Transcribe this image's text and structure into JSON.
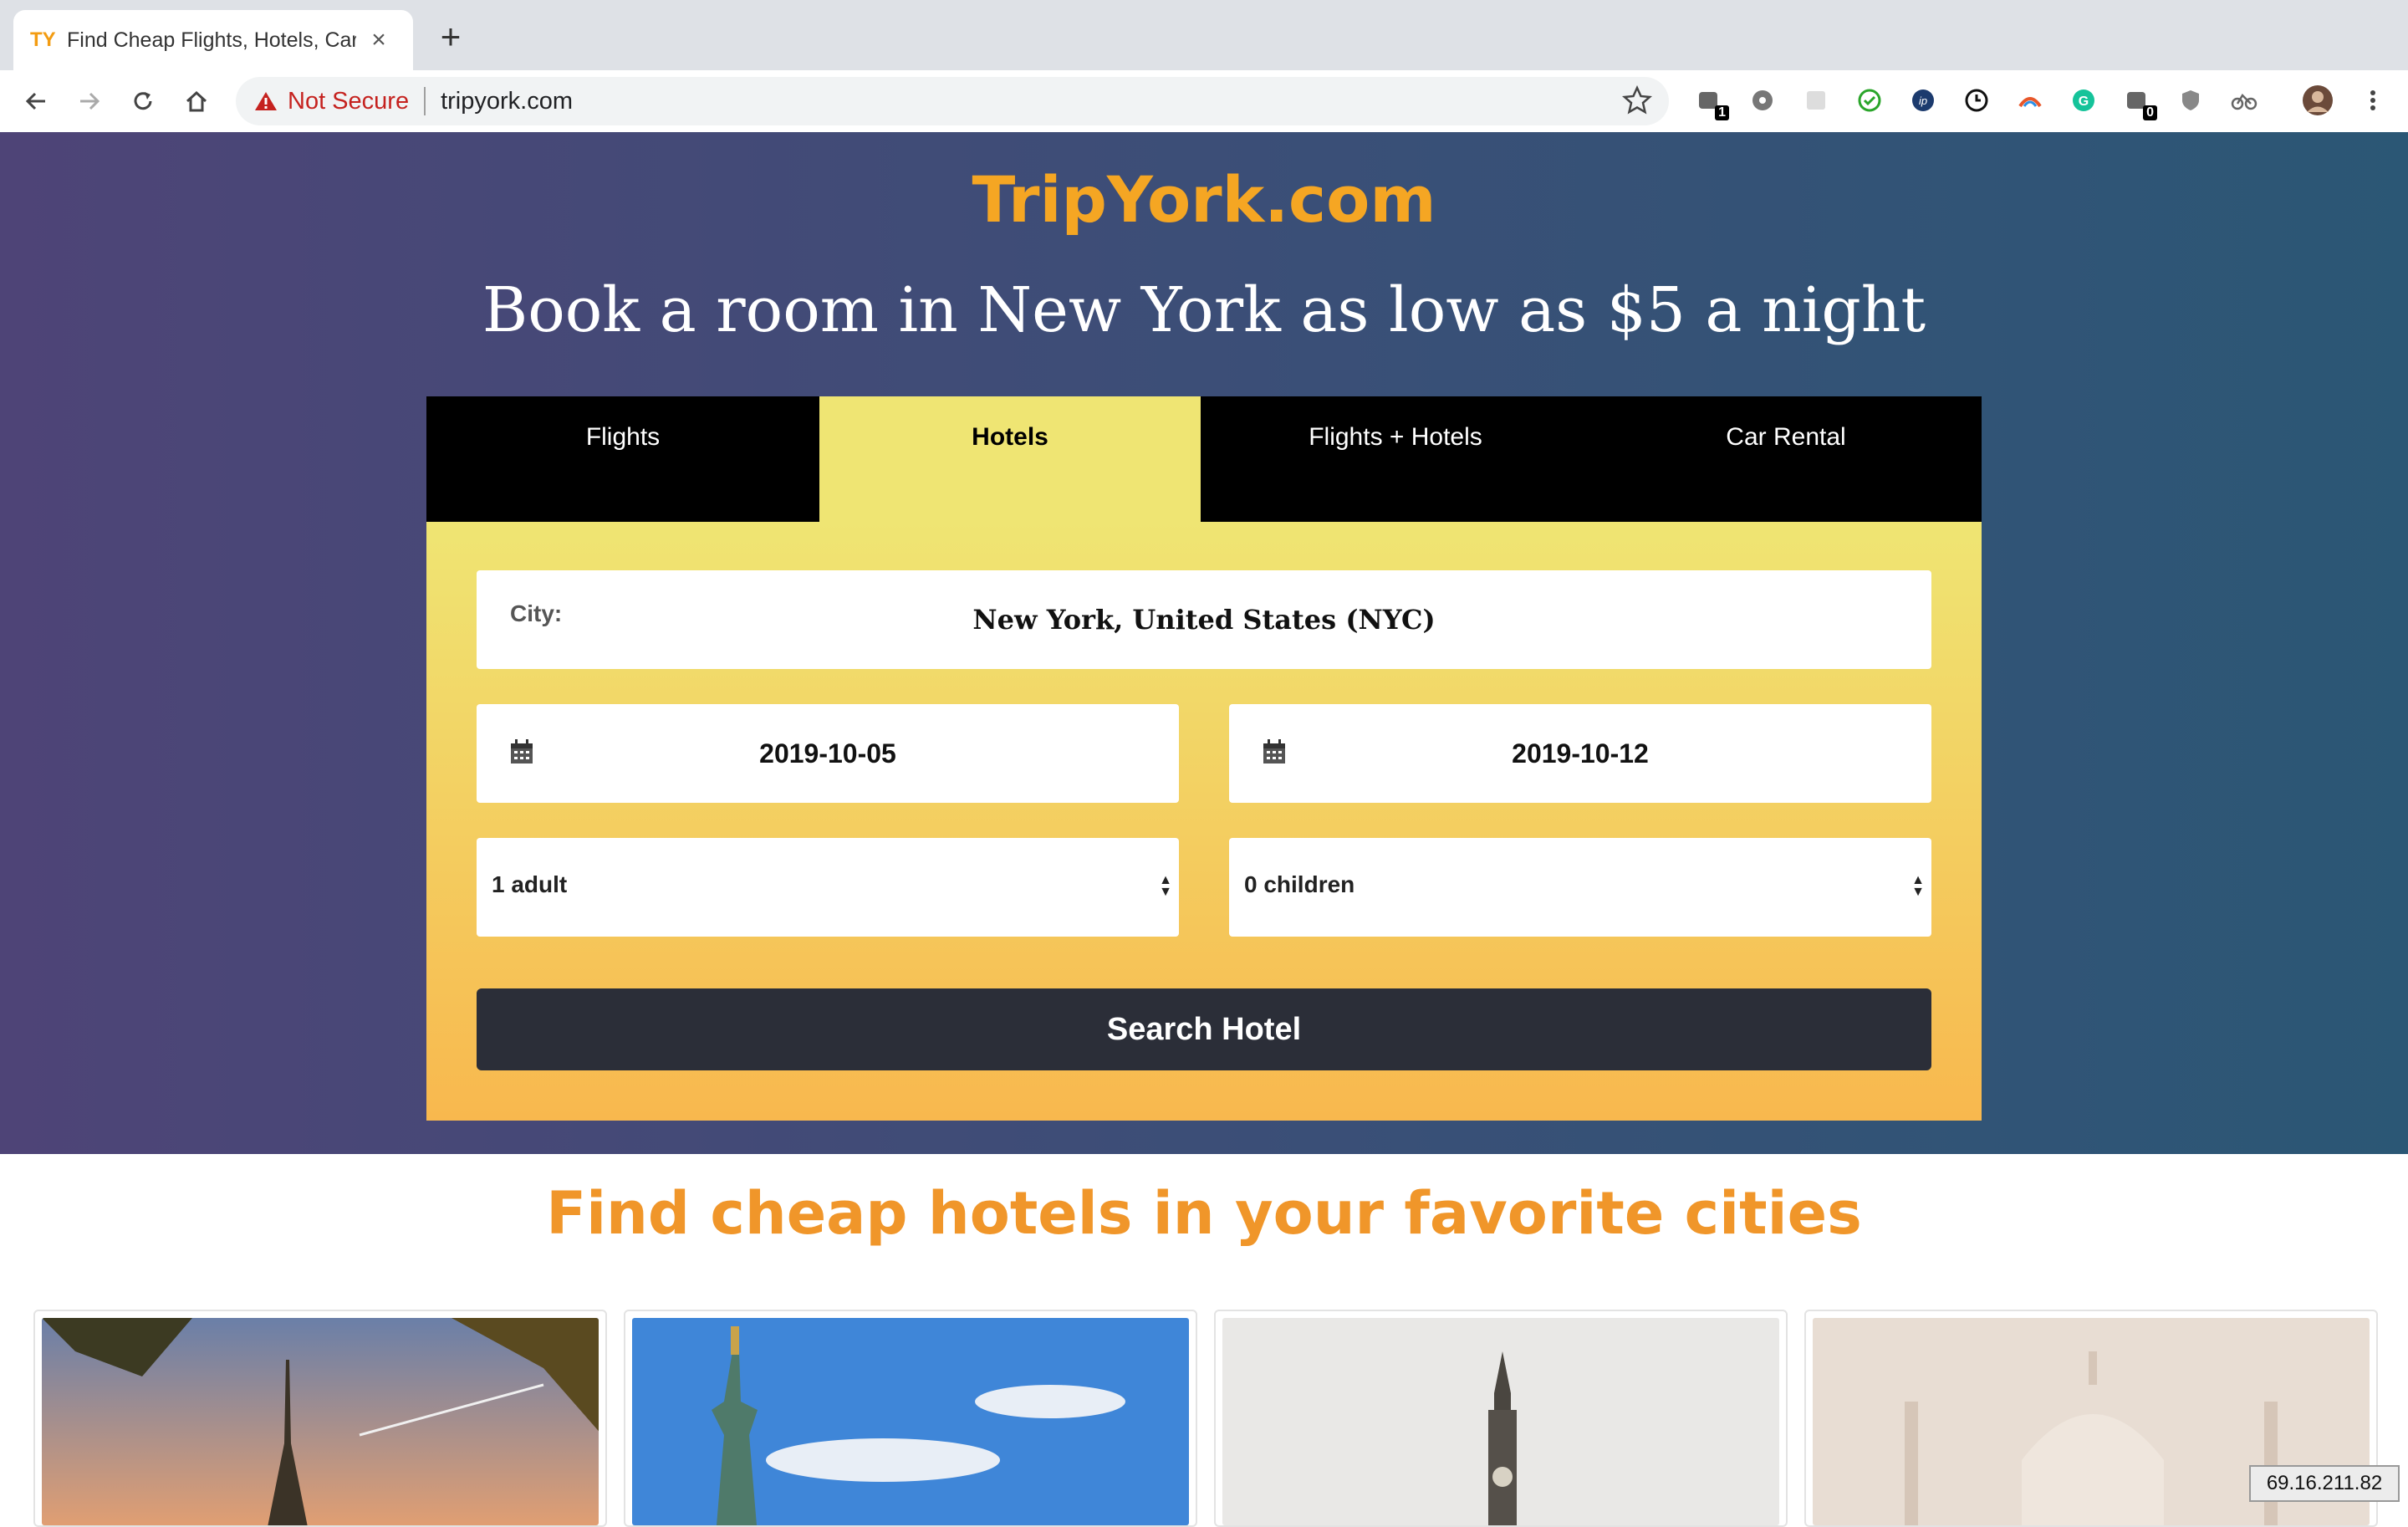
{
  "browser": {
    "tab_title": "Find Cheap Flights, Hotels, Car",
    "tab_favicon": "TY",
    "new_tab_label": "+",
    "security_label": "Not Secure",
    "url": "tripyork.com",
    "extension_badges": [
      "1",
      "0"
    ]
  },
  "page": {
    "brand": "TripYork.com",
    "headline": "Book a room in New York as low as $5 a night",
    "tabs": [
      {
        "label": "Flights"
      },
      {
        "label": "Hotels"
      },
      {
        "label": "Flights + Hotels"
      },
      {
        "label": "Car Rental"
      }
    ],
    "active_tab": "Hotels",
    "city_label": "City:",
    "city_value": "New York, United States (NYC)",
    "checkin_date": "2019-10-05",
    "checkout_date": "2019-10-12",
    "adults": "1 adult",
    "children": "0 children",
    "search_button": "Search Hotel",
    "section_title": "Find cheap hotels in your favorite cities",
    "cards": [
      {
        "image": "eiffel-tower"
      },
      {
        "image": "statue-of-liberty"
      },
      {
        "image": "big-ben"
      },
      {
        "image": "taj-mahal"
      }
    ]
  },
  "ip_address": "69.16.211.82",
  "colors": {
    "brand_orange": "#f5a623",
    "active_tab_yellow": "#efe573",
    "button_dark": "#2b2e38",
    "not_secure_red": "#c5221f"
  }
}
